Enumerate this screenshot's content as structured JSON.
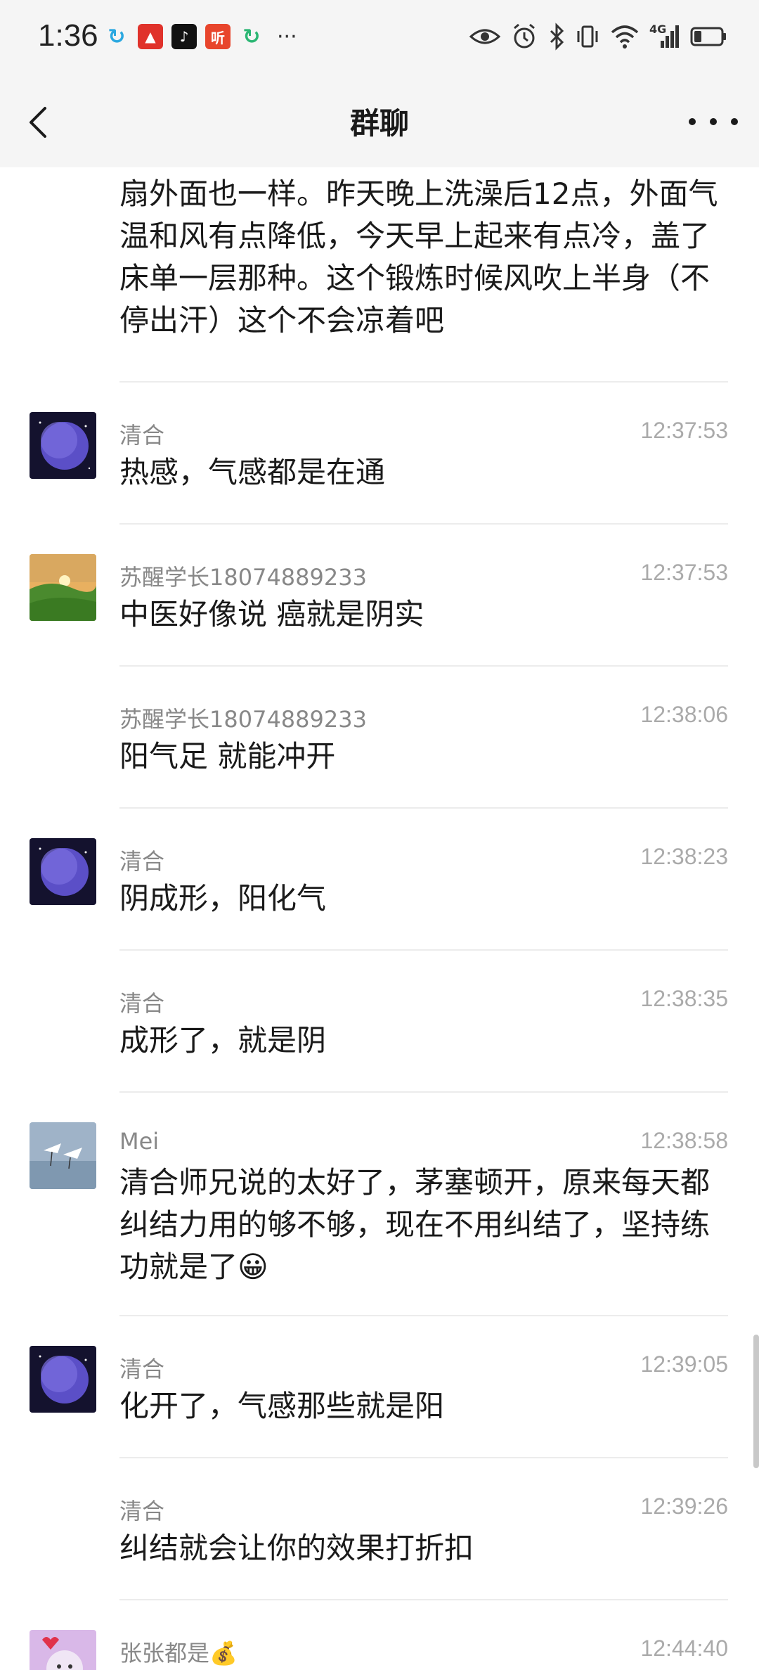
{
  "status_bar": {
    "time": "1:36",
    "network": "4G",
    "app_icons": [
      "refresh-app-icon",
      "red-app-icon",
      "tiktok-icon",
      "listen-app-icon",
      "sync-icon"
    ]
  },
  "nav": {
    "title": "群聊"
  },
  "messages": [
    {
      "text": "的毛相对比正常的大多点了，在家不吹空调风扇外面也一样。昨天晚上洗澡后12点，外面气温和风有点降低，今天早上起来有点冷，盖了床单一层那种。这个锻炼时候风吹上半身（不停出汗）这个不会凉着吧"
    },
    {
      "sender": "清合",
      "time": "12:37:53",
      "text": "热感，气感都是在通",
      "avatar": "planet"
    },
    {
      "sender": "苏醒学长18074889233",
      "time": "12:37:53",
      "text": "中医好像说 癌就是阴实",
      "avatar": "landscape"
    },
    {
      "sender": "苏醒学长18074889233",
      "time": "12:38:06",
      "text": "阳气足 就能冲开"
    },
    {
      "sender": "清合",
      "time": "12:38:23",
      "text": "阴成形，阳化气",
      "avatar": "planet"
    },
    {
      "sender": "清合",
      "time": "12:38:35",
      "text": "成形了，就是阴"
    },
    {
      "sender": "Mei",
      "time": "12:38:58",
      "text": "清合师兄说的太好了，茅塞顿开，原来每天都纠结力用的够不够，现在不用纠结了，坚持练功就是了😀",
      "avatar": "birds"
    },
    {
      "sender": "清合",
      "time": "12:39:05",
      "text": "化开了，气感那些就是阳",
      "avatar": "planet"
    },
    {
      "sender": "清合",
      "time": "12:39:26",
      "text": "纠结就会让你的效果打折扣"
    },
    {
      "sender": "张张都是💰",
      "time": "12:44:40",
      "avatar": "cartoon"
    }
  ],
  "colors": {
    "background": "#ffffff",
    "header": "#f5f5f5",
    "sender": "#888888",
    "time": "#aaaaaa",
    "divider": "#ececec"
  }
}
